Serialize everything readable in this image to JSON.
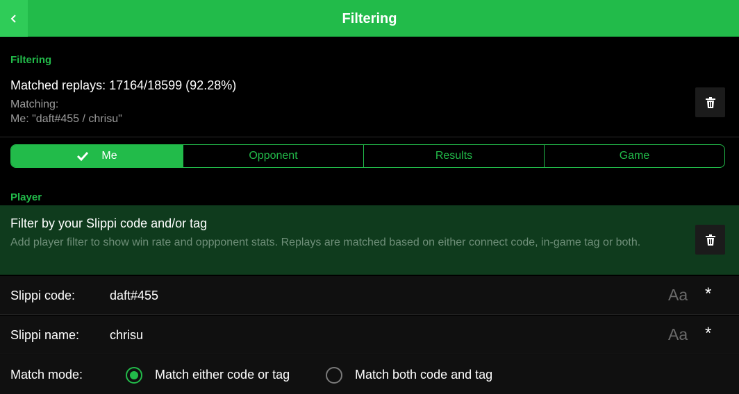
{
  "header": {
    "title": "Filtering",
    "back_icon": "chevron-left-icon",
    "color": "#22bb4a"
  },
  "filtering": {
    "section_title": "Filtering",
    "matched": "Matched replays: 17164/18599 (92.28%)",
    "matching_label": "Matching:",
    "matching_value": "Me: \"daft#455 / chrisu\"",
    "clear_icon": "trash-icon"
  },
  "tabs": [
    {
      "label": "Me",
      "active": true,
      "icon": "check-icon"
    },
    {
      "label": "Opponent",
      "active": false
    },
    {
      "label": "Results",
      "active": false
    },
    {
      "label": "Game",
      "active": false
    }
  ],
  "player": {
    "section_title": "Player",
    "card_title": "Filter by your Slippi code and/or tag",
    "card_desc": "Add player filter to show win rate and oppponent stats. Replays are matched based on either connect code, in-game tag or both.",
    "clear_icon": "trash-icon"
  },
  "fields": {
    "code_label": "Slippi code:",
    "code_value": "daft#455",
    "name_label": "Slippi name:",
    "name_value": "chrisu",
    "case_icon_text": "Aa",
    "wildcard_icon_text": "*"
  },
  "match_mode": {
    "label": "Match mode:",
    "options": [
      {
        "label": "Match either code or tag",
        "selected": true
      },
      {
        "label": "Match both code and tag",
        "selected": false
      }
    ]
  }
}
